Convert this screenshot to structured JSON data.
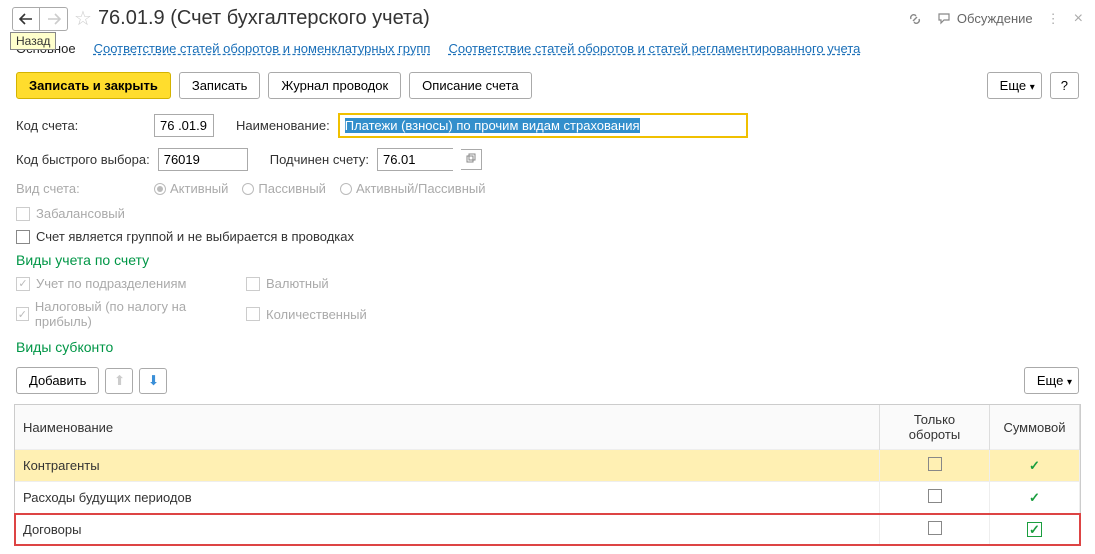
{
  "header": {
    "back_tooltip": "Назад",
    "title": "76.01.9 (Счет бухгалтерского учета)",
    "discussion": "Обсуждение"
  },
  "tabs": {
    "main": "Основное",
    "link1": "Соответствие статей оборотов и номенклатурных групп",
    "link2": "Соответствие статей оборотов и статей регламентированного учета"
  },
  "toolbar": {
    "save_close": "Записать и закрыть",
    "save": "Записать",
    "journal": "Журнал проводок",
    "description": "Описание счета",
    "more": "Еще",
    "help": "?"
  },
  "form": {
    "code_label": "Код счета:",
    "code_value": "76 .01.9",
    "name_label": "Наименование:",
    "name_value": "Платежи (взносы) по прочим видам страхования",
    "quick_label": "Код быстрого выбора:",
    "quick_value": "76019",
    "parent_label": "Подчинен счету:",
    "parent_value": "76.01",
    "type_label": "Вид счета:",
    "type_active": "Активный",
    "type_passive": "Пассивный",
    "type_both": "Активный/Пассивный",
    "offbalance": "Забалансовый",
    "is_group": "Счет является группой и не выбирается в проводках"
  },
  "accounting_types": {
    "header": "Виды учета по счету",
    "by_dept": "Учет по подразделениям",
    "currency": "Валютный",
    "tax": "Налоговый (по налогу на прибыль)",
    "quantity": "Количественный"
  },
  "subconto": {
    "header": "Виды субконто",
    "add": "Добавить",
    "more": "Еще",
    "columns": {
      "name": "Наименование",
      "turnover": "Только обороты",
      "sum": "Суммовой"
    },
    "rows": [
      {
        "name": "Контрагенты",
        "turnover": false,
        "sum": true,
        "selected": true,
        "highlighted": false
      },
      {
        "name": "Расходы будущих периодов",
        "turnover": false,
        "sum": true,
        "selected": false,
        "highlighted": false
      },
      {
        "name": "Договоры",
        "turnover": false,
        "sum": true,
        "selected": false,
        "highlighted": true
      }
    ]
  }
}
